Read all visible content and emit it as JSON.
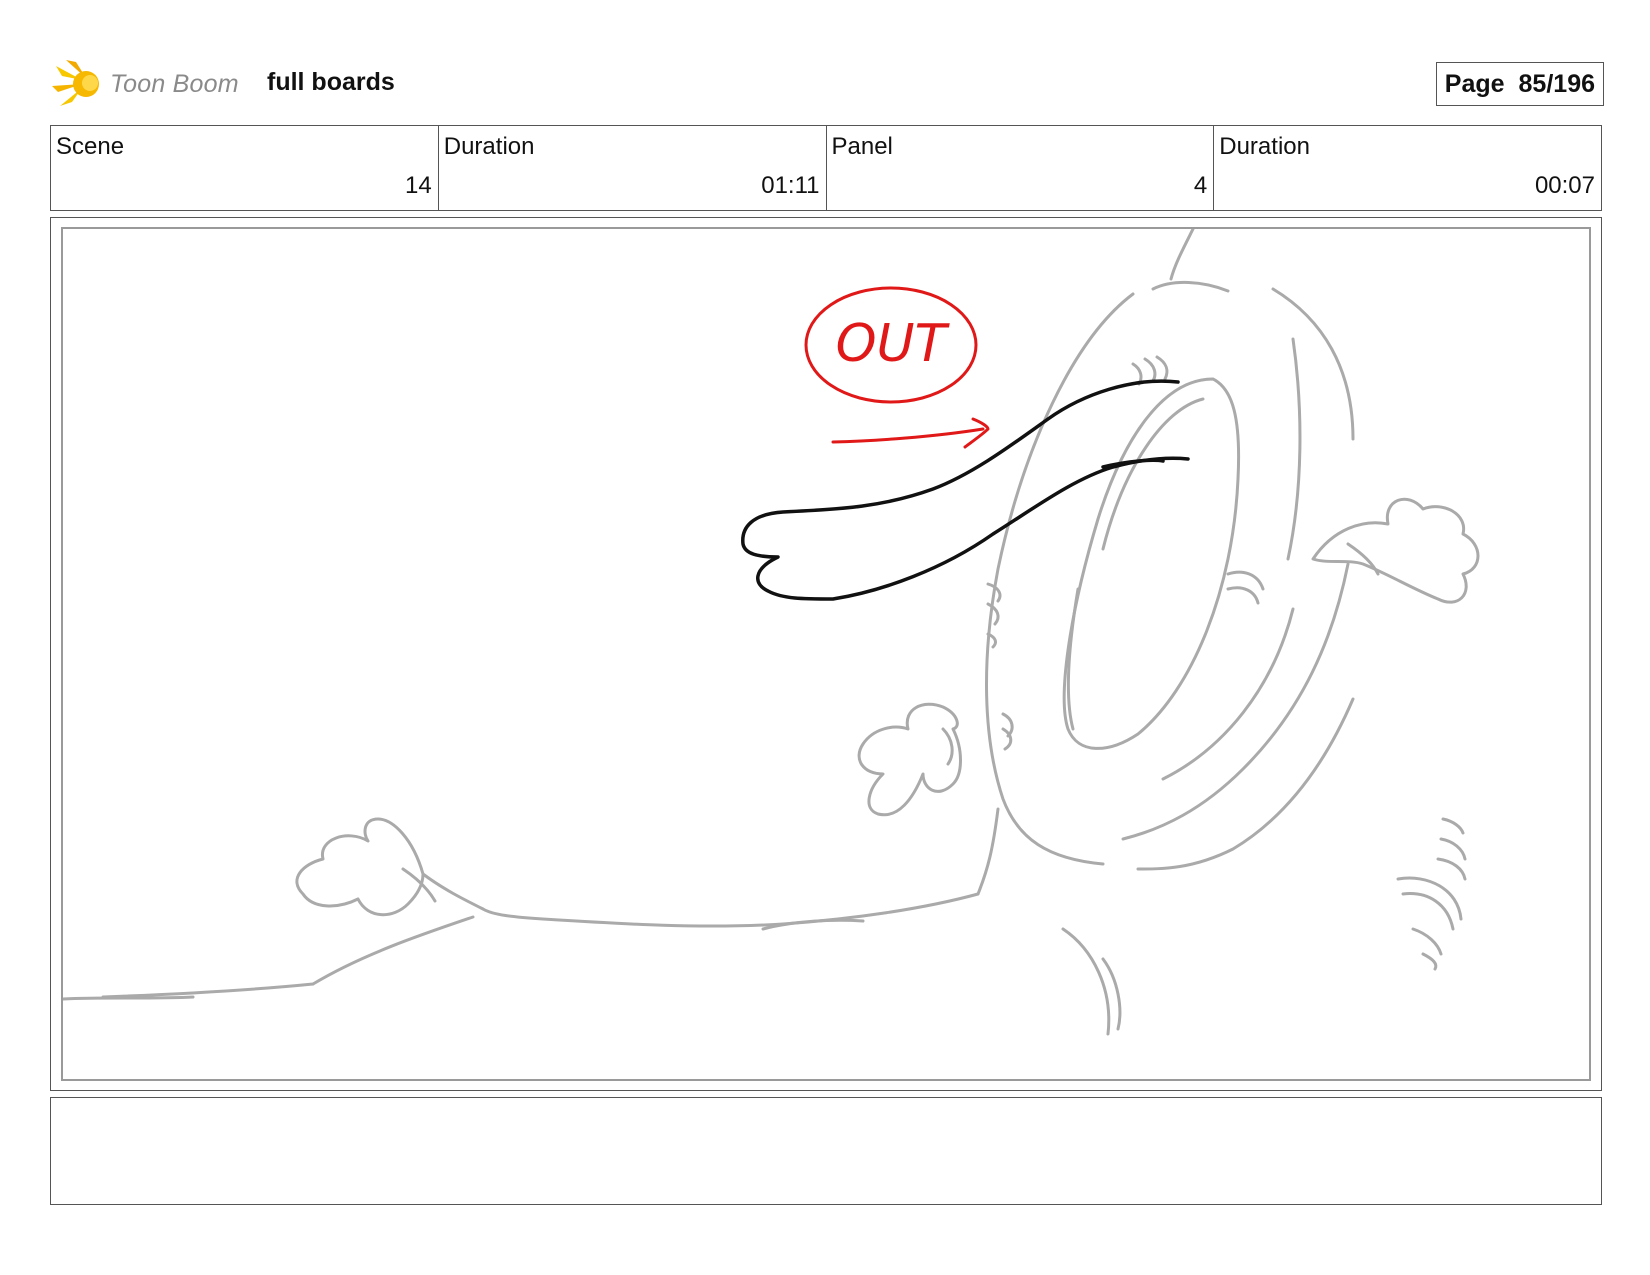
{
  "header": {
    "logo_text": "Toon Boom",
    "board_title": "full boards",
    "page_label": "Page",
    "page_number": "85/196"
  },
  "info": {
    "scene_label": "Scene",
    "scene_value": "14",
    "scene_duration_label": "Duration",
    "scene_duration_value": "01:11",
    "panel_label": "Panel",
    "panel_value": "4",
    "panel_duration_label": "Duration",
    "panel_duration_value": "00:07"
  },
  "panel": {
    "annotation_text": "OUT",
    "annotation_color": "#e01818",
    "sketch_color": "#aaaaaa",
    "ink_color": "#111111"
  },
  "notes": {
    "text": ""
  }
}
